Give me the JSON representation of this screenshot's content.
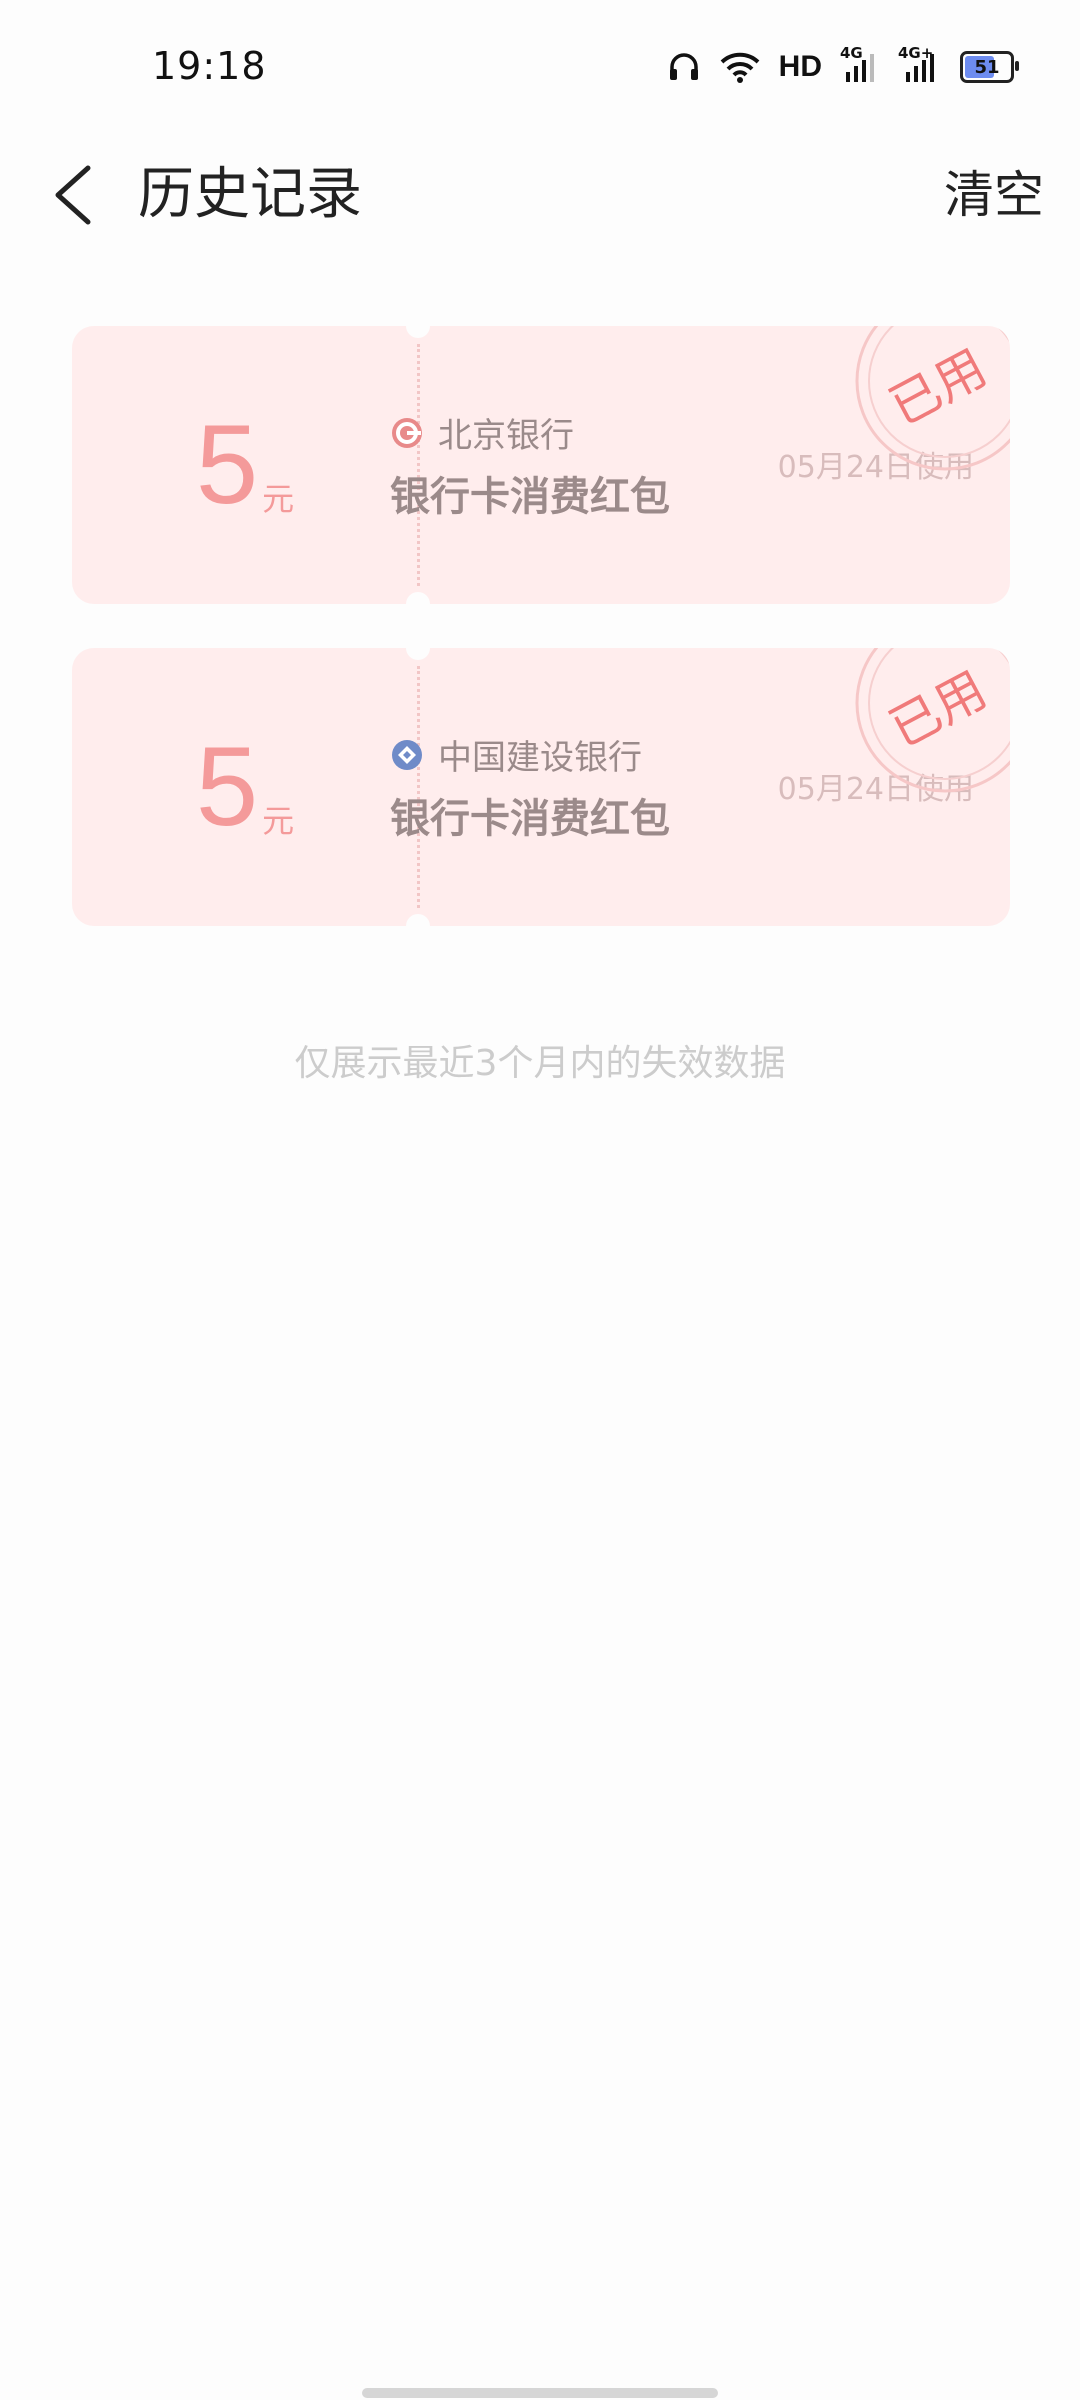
{
  "status_bar": {
    "time": "19:18",
    "network_hd": "HD",
    "signal_1": "4G",
    "signal_2": "4G+",
    "battery_level": "51"
  },
  "header": {
    "title": "历史记录",
    "clear_label": "清空"
  },
  "coupons": [
    {
      "amount": "5",
      "unit": "元",
      "bank_name": "北京银行",
      "bank_icon": "bank-of-beijing-logo",
      "title": "银行卡消费红包",
      "date": "05月24日使用",
      "stamp": "已用"
    },
    {
      "amount": "5",
      "unit": "元",
      "bank_name": "中国建设银行",
      "bank_icon": "ccb-logo",
      "title": "银行卡消费红包",
      "date": "05月24日使用",
      "stamp": "已用"
    }
  ],
  "footer_note": "仅展示最近3个月内的失效数据",
  "colors": {
    "card_bg": "#ffeded",
    "amount": "#f49a9a",
    "stamp": "#f07a7a",
    "ccb_blue": "#6f8bc8"
  }
}
